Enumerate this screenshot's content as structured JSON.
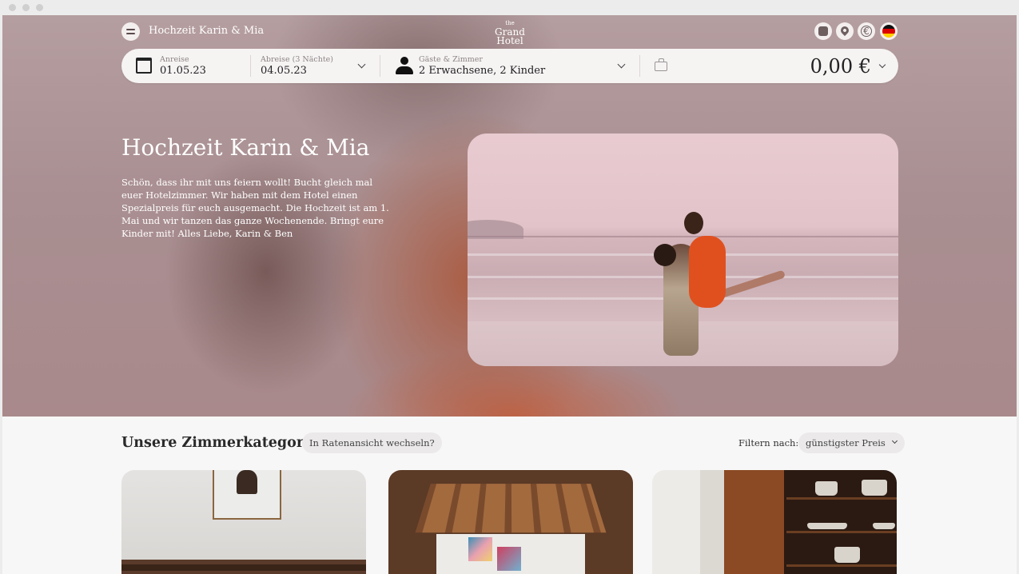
{
  "hero": {
    "topbar": {
      "title": "Hochzeit Karin & Mia",
      "logo": {
        "line1": "the",
        "line2": "Grand",
        "line3": "Hotel"
      },
      "icons": [
        "gallery-icon",
        "location-pin-icon",
        "euro-currency-icon",
        "german-flag-icon"
      ]
    },
    "booking": {
      "arrival_label": "Anreise",
      "arrival_value": "01.05.23",
      "departure_label": "Abreise (3 Nächte)",
      "departure_value": "04.05.23",
      "guests_label": "Gäste & Zimmer",
      "guests_value": "2 Erwachsene, 2 Kinder",
      "price": "0,00 €"
    },
    "title": "Hochzeit Karin & Mia",
    "description": "Schön, dass ihr mit uns feiern wollt! Bucht gleich mal euer Hotelzimmer. Wir haben mit dem Hotel einen Spezialpreis für euch ausgemacht. Die Hochzeit ist am 1. Mai und wir tanzen das ganze Wochenende. Bringt eure Kinder mit! Alles Liebe, Karin & Ben"
  },
  "rooms": {
    "section_title": "Unsere Zimmerkategorien",
    "rate_view_button": "In Ratenansicht wechseln?",
    "filter_label": "Filtern nach:",
    "filter_value": "günstigster Preis"
  },
  "colors": {
    "hero_base": "#a98f92",
    "hero_accent": "#c45c38",
    "content_bg": "#f8f7f7",
    "booking_bg": "#f6f3f3"
  }
}
